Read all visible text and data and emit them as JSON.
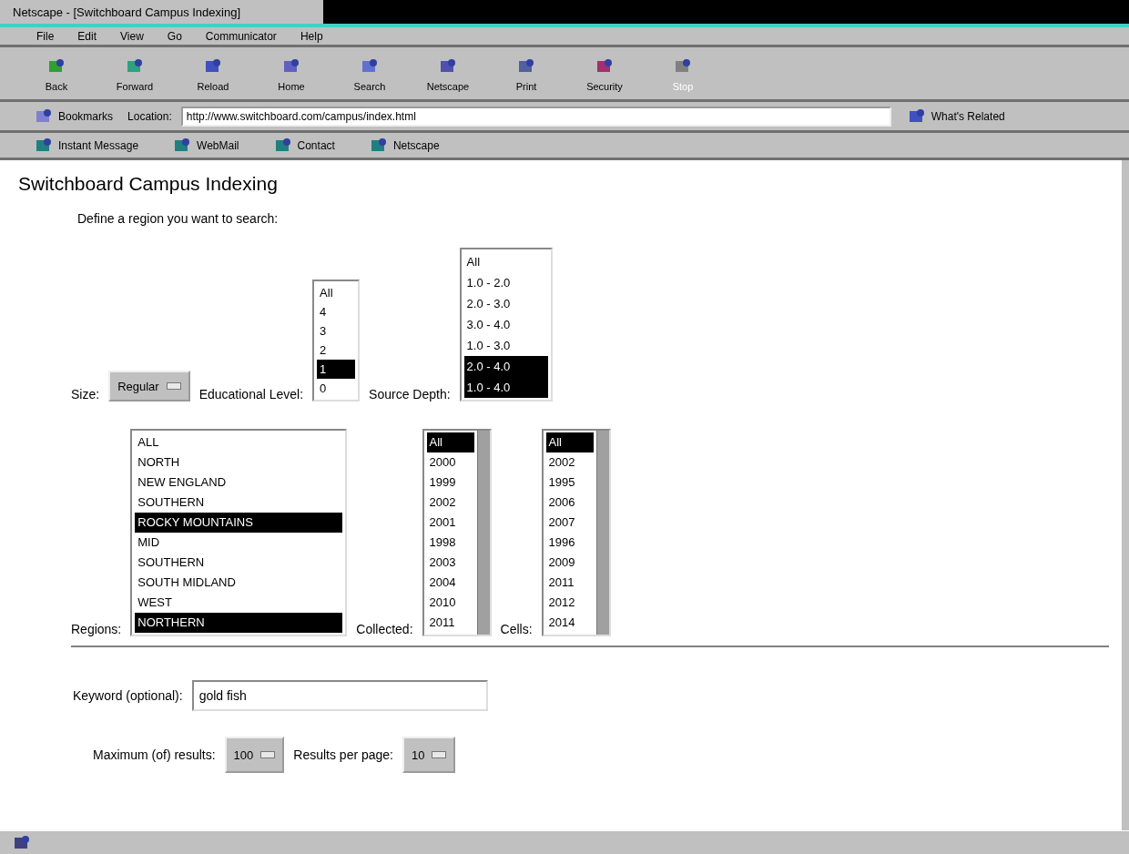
{
  "window": {
    "title": "Netscape - [Switchboard Campus Indexing]"
  },
  "menu": [
    "File",
    "Edit",
    "View",
    "Go",
    "Communicator",
    "Help"
  ],
  "toolbar": [
    {
      "label": "Back",
      "disabled": false
    },
    {
      "label": "Forward",
      "disabled": false
    },
    {
      "label": "Reload",
      "disabled": false
    },
    {
      "label": "Home",
      "disabled": false
    },
    {
      "label": "Search",
      "disabled": false
    },
    {
      "label": "Netscape",
      "disabled": false
    },
    {
      "label": "Print",
      "disabled": false
    },
    {
      "label": "Security",
      "disabled": false
    },
    {
      "label": "Stop",
      "disabled": true
    }
  ],
  "location": {
    "bookmarks": "Bookmarks",
    "label": "Location:",
    "url": "http://www.switchboard.com/campus/index.html",
    "related": "What's Related"
  },
  "personal": [
    "Instant Message",
    "WebMail",
    "Contact",
    "Netscape"
  ],
  "page": {
    "heading": "Switchboard Campus Indexing",
    "intro": "Define a region you want to search:",
    "size": {
      "label": "Size:",
      "value": "Regular"
    },
    "education": {
      "label": "Educational Level:",
      "items": [
        {
          "text": "All",
          "selected": false
        },
        {
          "text": "4",
          "selected": false
        },
        {
          "text": "3",
          "selected": false
        },
        {
          "text": "2",
          "selected": false
        },
        {
          "text": "1",
          "selected": true
        },
        {
          "text": "0",
          "selected": false
        }
      ]
    },
    "depth": {
      "label": "Source Depth:",
      "items": [
        {
          "text": "All",
          "selected": false
        },
        {
          "text": "1.0 - 2.0",
          "selected": false
        },
        {
          "text": "2.0 - 3.0",
          "selected": false
        },
        {
          "text": "3.0 - 4.0",
          "selected": false
        },
        {
          "text": "1.0 - 3.0",
          "selected": false
        },
        {
          "text": "2.0 - 4.0",
          "selected": true
        },
        {
          "text": "1.0 - 4.0",
          "selected": true
        }
      ]
    },
    "regions": {
      "label": "Regions:",
      "items": [
        {
          "text": "ALL",
          "selected": false
        },
        {
          "text": "NORTH",
          "selected": false
        },
        {
          "text": "NEW ENGLAND",
          "selected": false
        },
        {
          "text": "SOUTHERN",
          "selected": false
        },
        {
          "text": "ROCKY MOUNTAINS",
          "selected": true
        },
        {
          "text": "MID",
          "selected": false
        },
        {
          "text": "SOUTHERN",
          "selected": false
        },
        {
          "text": "SOUTH MIDLAND",
          "selected": false
        },
        {
          "text": "WEST",
          "selected": false
        },
        {
          "text": "NORTHERN",
          "selected": true
        }
      ]
    },
    "collected": {
      "label": "Collected:",
      "items": [
        {
          "text": "All",
          "selected": true
        },
        {
          "text": "2000",
          "selected": false
        },
        {
          "text": "1999",
          "selected": false
        },
        {
          "text": "2002",
          "selected": false
        },
        {
          "text": "2001",
          "selected": false
        },
        {
          "text": "1998",
          "selected": false
        },
        {
          "text": "2003",
          "selected": false
        },
        {
          "text": "2004",
          "selected": false
        },
        {
          "text": "2010",
          "selected": false
        },
        {
          "text": "2011",
          "selected": false
        }
      ]
    },
    "cells": {
      "label": "Cells:",
      "items": [
        {
          "text": "All",
          "selected": true
        },
        {
          "text": "2002",
          "selected": false
        },
        {
          "text": "1995",
          "selected": false
        },
        {
          "text": "2006",
          "selected": false
        },
        {
          "text": "2007",
          "selected": false
        },
        {
          "text": "1996",
          "selected": false
        },
        {
          "text": "2009",
          "selected": false
        },
        {
          "text": "2011",
          "selected": false
        },
        {
          "text": "2012",
          "selected": false
        },
        {
          "text": "2014",
          "selected": false
        }
      ]
    },
    "keyword": {
      "label": "Keyword (optional):",
      "value": "gold fish"
    },
    "maximum": {
      "label": "Maximum (of) results:",
      "value": "100"
    },
    "display": {
      "label": "Results per page:",
      "value": "10"
    }
  }
}
